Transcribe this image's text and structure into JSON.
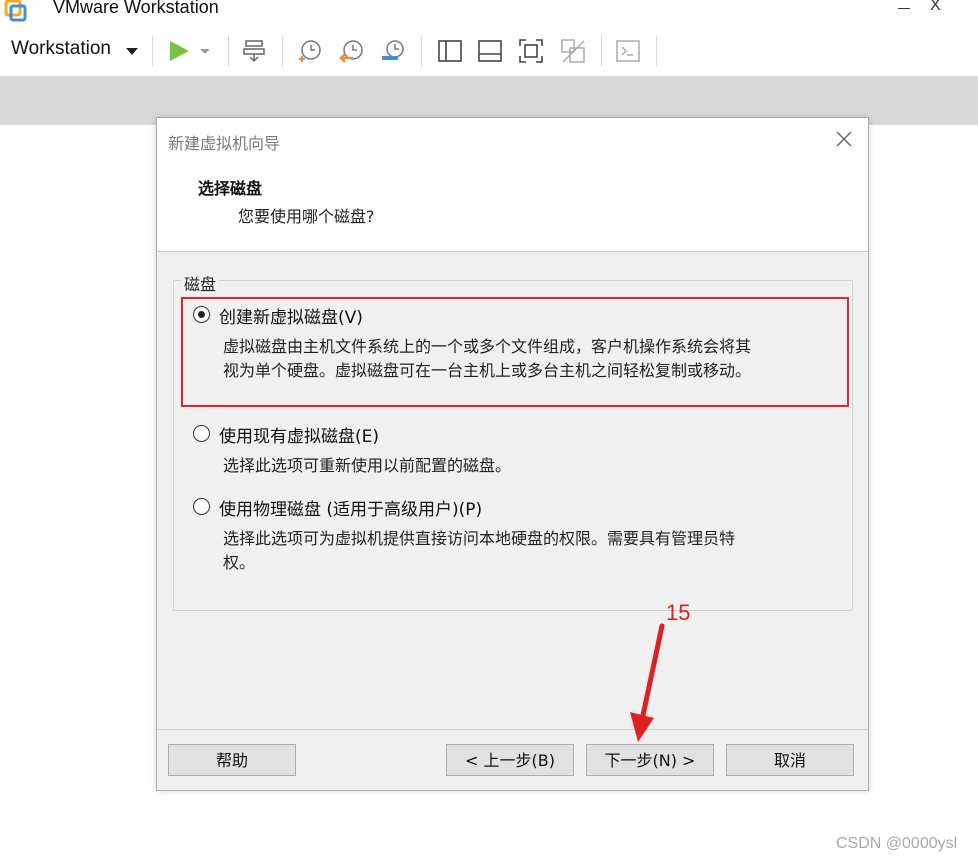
{
  "window": {
    "title": "VMware Workstation",
    "close_glyph": "X"
  },
  "toolbar": {
    "menu_label": "Workstation",
    "icons": [
      "play-icon",
      "play-dropdown-icon",
      "network-icon",
      "snapshot-take-icon",
      "snapshot-revert-icon",
      "snapshot-manager-icon",
      "sidebar-view-icon",
      "console-view-icon",
      "fullscreen-icon",
      "unity-icon",
      "terminal-icon"
    ]
  },
  "dialog": {
    "title": "新建虚拟机向导",
    "step_title": "选择磁盘",
    "step_subtitle": "您要使用哪个磁盘?",
    "group_label": "磁盘",
    "options": [
      {
        "label": "创建新虚拟磁盘(V)",
        "selected": true,
        "desc_line1": "虚拟磁盘由主机文件系统上的一个或多个文件组成，客户机操作系统会将其",
        "desc_line2": "视为单个硬盘。虚拟磁盘可在一台主机上或多台主机之间轻松复制或移动。"
      },
      {
        "label": "使用现有虚拟磁盘(E)",
        "selected": false,
        "desc_line1": "选择此选项可重新使用以前配置的磁盘。"
      },
      {
        "label": "使用物理磁盘 (适用于高级用户)(P)",
        "selected": false,
        "desc_line1": "选择此选项可为虚拟机提供直接访问本地硬盘的权限。需要具有管理员特",
        "desc_line2": "权。"
      }
    ],
    "buttons": {
      "help": "帮助",
      "back": "< 上一步(B)",
      "next": "下一步(N) >",
      "cancel": "取消"
    }
  },
  "annotation": {
    "step_number": "15",
    "color": "#e02020"
  },
  "watermark": "CSDN @0000ysl",
  "colors": {
    "accent_play": "#7ac143",
    "highlight_red": "#e0252e",
    "dialog_bg": "#f0f0f0",
    "band_gray": "#d9d9d9"
  }
}
